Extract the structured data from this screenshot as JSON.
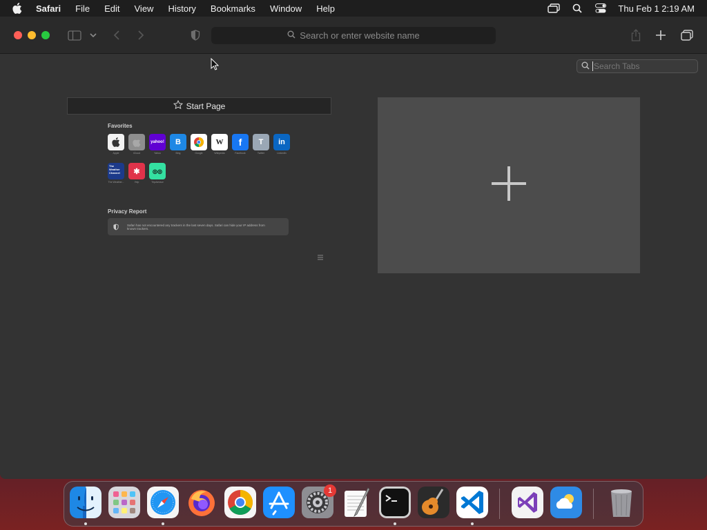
{
  "menubar": {
    "app_name": "Safari",
    "items": [
      "File",
      "Edit",
      "View",
      "History",
      "Bookmarks",
      "Window",
      "Help"
    ],
    "clock": "Thu Feb 1  2:19 AM"
  },
  "toolbar": {
    "address_placeholder": "Search or enter website name"
  },
  "tab_overview": {
    "search_placeholder": "Search Tabs",
    "tabs": [
      {
        "title": "Start Page",
        "favorites_heading": "Favorites",
        "favorites": [
          {
            "label": "Apple",
            "glyph": "",
            "color": "#f2f2f2"
          },
          {
            "label": "iCloud",
            "glyph": "",
            "color": "#8e8e8e"
          },
          {
            "label": "Yahoo",
            "glyph": "yahoo!",
            "color": "#6001d2"
          },
          {
            "label": "Bing",
            "glyph": "B",
            "color": "#1e88e5"
          },
          {
            "label": "Google",
            "glyph": "",
            "color": "#ffffff"
          },
          {
            "label": "Wikipedia",
            "glyph": "W",
            "color": "#ffffff"
          },
          {
            "label": "Facebook",
            "glyph": "f",
            "color": "#1877f2"
          },
          {
            "label": "Twitter",
            "glyph": "T",
            "color": "#9aa7b5"
          },
          {
            "label": "LinkedIn",
            "glyph": "in",
            "color": "#0a66c2"
          },
          {
            "label": "The Weather...",
            "glyph": "The Weather Channel",
            "color": "#1c3a8a"
          },
          {
            "label": "Yelp",
            "glyph": "✱",
            "color": "#e0334a"
          },
          {
            "label": "TripAdvisor",
            "glyph": "◎◎",
            "color": "#34e0a1"
          }
        ],
        "privacy_heading": "Privacy Report",
        "privacy_text": "Safari has not encountered any trackers in the last seven days. Safari can hide your IP address from known trackers."
      },
      {
        "title": "",
        "new_tab": true
      }
    ]
  },
  "dock": {
    "apps": [
      {
        "name": "Finder",
        "running": true
      },
      {
        "name": "Launchpad",
        "running": false
      },
      {
        "name": "Safari",
        "running": true
      },
      {
        "name": "Firefox",
        "running": false
      },
      {
        "name": "Google Chrome",
        "running": false
      },
      {
        "name": "App Store",
        "running": false
      },
      {
        "name": "System Settings",
        "running": false,
        "badge": "1"
      },
      {
        "name": "TextEdit",
        "running": false
      },
      {
        "name": "Terminal",
        "running": true
      },
      {
        "name": "GarageBand",
        "running": false
      },
      {
        "name": "Visual Studio Code",
        "running": true
      },
      {
        "name": "Visual Studio",
        "running": false
      },
      {
        "name": "Weather",
        "running": false
      },
      {
        "name": "Trash",
        "running": false
      }
    ]
  }
}
